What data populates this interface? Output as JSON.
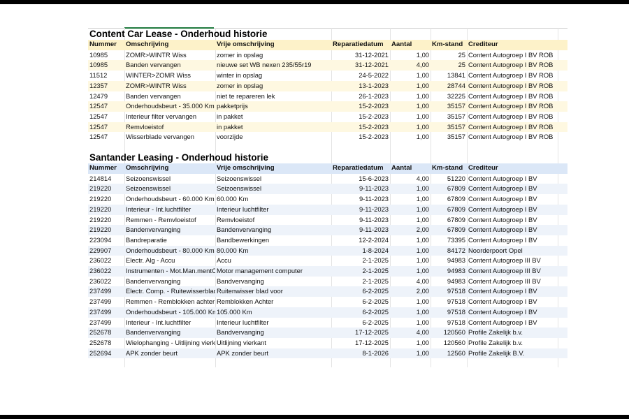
{
  "headers": [
    "Nummer",
    "Omschrijving",
    "Vrije omschrijving",
    "Reparatiedatum",
    "Aantal",
    "Km-stand",
    "Crediteur"
  ],
  "table1": {
    "title": "Content Car Lease - Onderhoud historie",
    "rows": [
      [
        "10985",
        "ZOMR>WINTR Wiss",
        "zomer in opslag",
        "31-12-2021",
        "1,00",
        "25",
        "Content Autogroep I BV ROB"
      ],
      [
        "10985",
        "Banden vervangen",
        "nieuwe set WB nexen 235/55r19",
        "31-12-2021",
        "4,00",
        "25",
        "Content Autogroep I BV ROB"
      ],
      [
        "11512",
        "WINTER>ZOMR Wiss",
        "winter in opslag",
        "24-5-2022",
        "1,00",
        "13841",
        "Content Autogroep I BV ROB"
      ],
      [
        "12357",
        "ZOMR>WINTR Wiss",
        "zomer in opslag",
        "13-1-2023",
        "1,00",
        "28744",
        "Content Autogroep I BV ROB"
      ],
      [
        "12479",
        "Banden vervangen",
        "niet te repareren lek",
        "26-1-2023",
        "1,00",
        "32225",
        "Content Autogroep I BV ROB"
      ],
      [
        "12547",
        "Onderhoudsbeurt - 35.000 Km",
        "pakketprijs",
        "15-2-2023",
        "1,00",
        "35157",
        "Content Autogroep I BV ROB"
      ],
      [
        "12547",
        "Interieur filter vervangen",
        "in pakket",
        "15-2-2023",
        "1,00",
        "35157",
        "Content Autogroep I BV ROB"
      ],
      [
        "12547",
        "Remvloeistof",
        "in pakket",
        "15-2-2023",
        "1,00",
        "35157",
        "Content Autogroep I BV ROB"
      ],
      [
        "12547",
        "Wisserblade vervangen",
        "voorzijde",
        "15-2-2023",
        "1,00",
        "35157",
        "Content Autogroep I BV ROB"
      ]
    ]
  },
  "table2": {
    "title": "Santander Leasing - Onderhoud historie",
    "rows": [
      [
        "214814",
        "Seizoenswissel",
        "Seizoenswissel",
        "15-6-2023",
        "4,00",
        "51220",
        "Content Autogroep I BV"
      ],
      [
        "219220",
        "Seizoenswissel",
        "Seizoenswissel",
        "9-11-2023",
        "1,00",
        "67809",
        "Content Autogroep I BV"
      ],
      [
        "219220",
        "Onderhoudsbeurt - 60.000 Km",
        "60.000 Km",
        "9-11-2023",
        "1,00",
        "67809",
        "Content Autogroep I BV"
      ],
      [
        "219220",
        "Interieur - Int.luchtfilter",
        "Interieur luchtfilter",
        "9-11-2023",
        "1,00",
        "67809",
        "Content Autogroep I BV"
      ],
      [
        "219220",
        "Remmen - Remvloeistof",
        "Remvloeistof",
        "9-11-2023",
        "1,00",
        "67809",
        "Content Autogroep I BV"
      ],
      [
        "219220",
        "Bandenvervanging",
        "Bandenvervanging",
        "9-11-2023",
        "2,00",
        "67809",
        "Content Autogroep I BV"
      ],
      [
        "223094",
        "Bandreparatie",
        "Bandbewerkingen",
        "12-2-2024",
        "1,00",
        "73395",
        "Content Autogroep I BV"
      ],
      [
        "229907",
        "Onderhoudsbeurt - 80.000 Km",
        "80.000 Km",
        "1-8-2024",
        "1,00",
        "84172",
        "Noorderpoort Opel"
      ],
      [
        "236022",
        "Electr. Alg - Accu",
        "Accu",
        "2-1-2025",
        "1,00",
        "94983",
        "Content Autogroep III BV"
      ],
      [
        "236022",
        "Instrumenten - Mot.Man.mentC",
        "Motor management computer",
        "2-1-2025",
        "1,00",
        "94983",
        "Content Autogroep III BV"
      ],
      [
        "236022",
        "Bandenvervanging",
        "Bandvervanging",
        "2-1-2025",
        "4,00",
        "94983",
        "Content Autogroep III BV"
      ],
      [
        "237499",
        "Electr. Comp. - Ruitewisserblad",
        "Ruitenwisser blad voor",
        "6-2-2025",
        "2,00",
        "97518",
        "Content Autogroep I BV"
      ],
      [
        "237499",
        "Remmen - Remblokken achter",
        "Remblokken Achter",
        "6-2-2025",
        "1,00",
        "97518",
        "Content Autogroep I BV"
      ],
      [
        "237499",
        "Onderhoudsbeurt - 105.000 Km",
        "105.000 Km",
        "6-2-2025",
        "1,00",
        "97518",
        "Content Autogroep I BV"
      ],
      [
        "237499",
        "Interieur - Int.luchtfilter",
        "Interieur luchtfilter",
        "6-2-2025",
        "1,00",
        "97518",
        "Content Autogroep I BV"
      ],
      [
        "252678",
        "Bandenvervanging",
        "Bandvervanging",
        "17-12-2025",
        "4,00",
        "120560",
        "Profile Zakelijk b.v."
      ],
      [
        "252678",
        "Wielophanging - Uitlijning vierka",
        "Uitlijning vierkant",
        "17-12-2025",
        "1,00",
        "120560",
        "Profile Zakelijk b.v."
      ],
      [
        "252694",
        "APK zonder beurt",
        "APK zonder beurt",
        "8-1-2026",
        "1,00",
        "12560",
        "Profile Zakelijk B.V."
      ]
    ]
  }
}
